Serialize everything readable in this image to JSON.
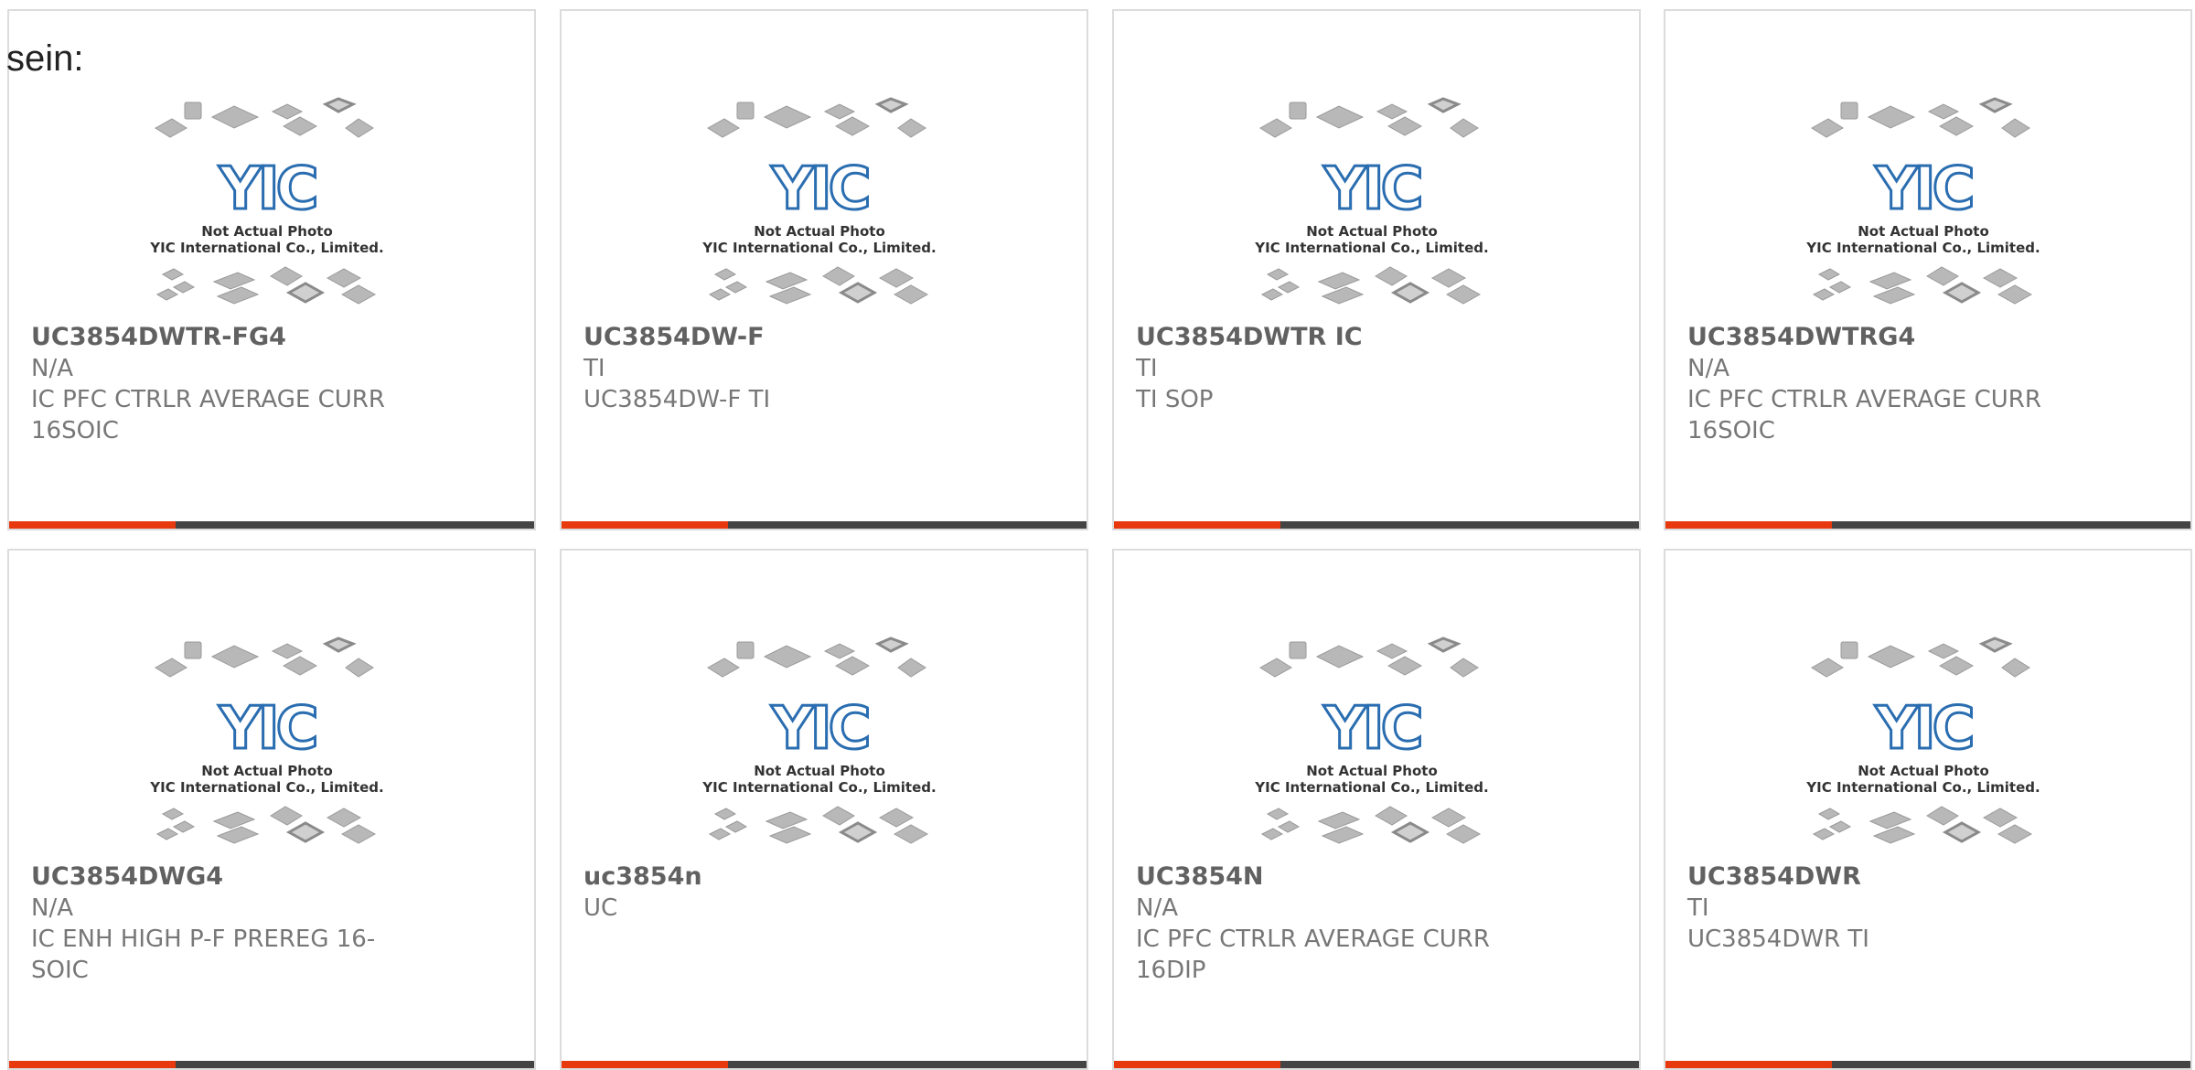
{
  "page": {
    "lead_text": "sein:"
  },
  "placeholder_image": {
    "logo_text": "YIC",
    "caption_line1": "Not Actual Photo",
    "caption_line2": "YIC International Co., Limited.",
    "logo_color": "#2a6db0",
    "chip_color": "#b8b8b8"
  },
  "accent_colors": {
    "progress_orange": "#e8380d",
    "bar_dark": "#444444"
  },
  "products": [
    {
      "part_number": "UC3854DWTR-FG4",
      "manufacturer": "N/A",
      "description": "IC PFC CTRLR AVERAGE CURR 16SOIC"
    },
    {
      "part_number": "UC3854DW-F",
      "manufacturer": "TI",
      "description": "UC3854DW-F TI"
    },
    {
      "part_number": "UC3854DWTR IC",
      "manufacturer": "TI",
      "description": "TI SOP"
    },
    {
      "part_number": "UC3854DWTRG4",
      "manufacturer": "N/A",
      "description": "IC PFC CTRLR AVERAGE CURR 16SOIC"
    },
    {
      "part_number": "UC3854DWG4",
      "manufacturer": "N/A",
      "description": "IC ENH HIGH P-F PREREG 16-SOIC"
    },
    {
      "part_number": "uc3854n",
      "manufacturer": "UC",
      "description": ""
    },
    {
      "part_number": "UC3854N",
      "manufacturer": "N/A",
      "description": "IC PFC CTRLR AVERAGE CURR 16DIP"
    },
    {
      "part_number": "UC3854DWR",
      "manufacturer": "TI",
      "description": "UC3854DWR TI"
    }
  ]
}
